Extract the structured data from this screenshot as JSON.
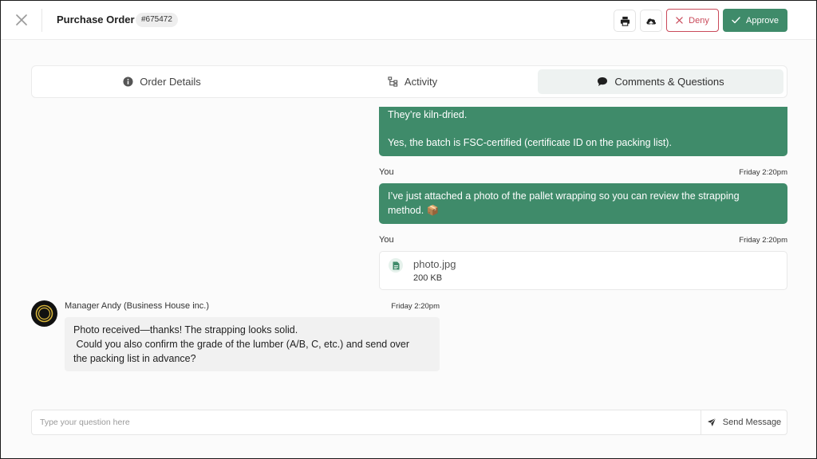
{
  "header": {
    "title": "Purchase Order",
    "order_number": "#675472",
    "deny_label": "Deny",
    "approve_label": "Approve"
  },
  "tabs": [
    {
      "label": "Order Details",
      "icon": "info-icon",
      "active": false
    },
    {
      "label": "Activity",
      "icon": "hierarchy-icon",
      "active": false
    },
    {
      "label": "Comments & Questions",
      "icon": "chat-bubble-icon",
      "active": true
    }
  ],
  "messages": {
    "first": {
      "line1": "They’re kiln-dried.",
      "line2": "Yes, the batch is FSC-certified (certificate ID on the packing list)."
    },
    "second": {
      "author": "You",
      "time": "Friday 2:20pm",
      "text_line1": "I’ve just attached a photo of the pallet wrapping so you can review the strapping",
      "text_line2": "method. 📦"
    },
    "third": {
      "author": "You",
      "time": "Friday 2:20pm",
      "file_name": "photo.jpg",
      "file_size": "200 KB"
    },
    "reply": {
      "author": "Manager Andy (Business House inc.)",
      "time": "Friday 2:20pm",
      "line1": "Photo received—thanks! The strapping looks solid.",
      "line2": " Could you also confirm the grade of the lumber (A/B, C, etc.) and send over",
      "line3": "the packing list in advance?"
    }
  },
  "composer": {
    "placeholder": "Type your question here",
    "send_label": "Send Message"
  },
  "colors": {
    "accent": "#3f8b6a",
    "deny": "#c94a5a",
    "tab_active_bg": "#eef2f1"
  }
}
